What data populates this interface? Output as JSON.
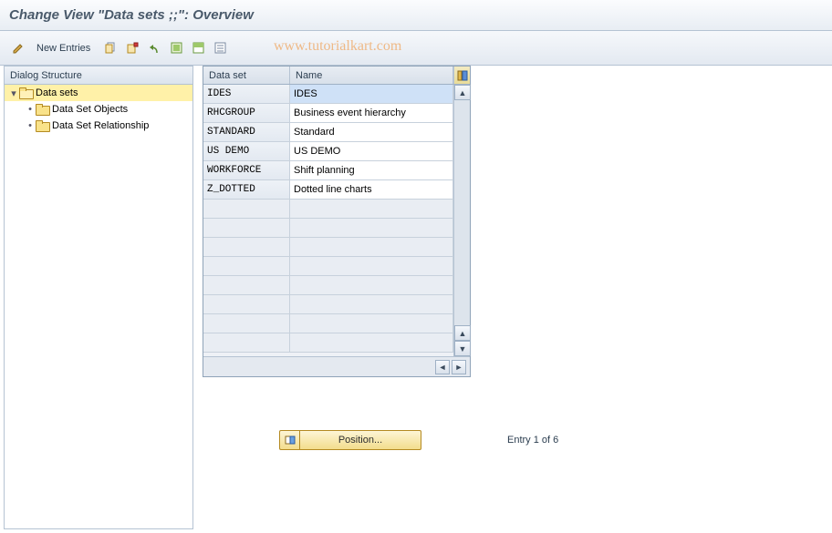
{
  "page_title": "Change View \"Data sets                    ;;\": Overview",
  "toolbar": {
    "new_entries": "New Entries"
  },
  "watermark": "www.tutorialkart.com",
  "tree": {
    "header": "Dialog Structure",
    "root": {
      "label": "Data sets",
      "children": [
        {
          "label": "Data Set Objects"
        },
        {
          "label": "Data Set Relationship"
        }
      ]
    }
  },
  "grid": {
    "columns": {
      "c1": "Data set",
      "c2": "Name"
    },
    "rows": [
      {
        "data_set": "IDES",
        "name": "IDES",
        "selected": true
      },
      {
        "data_set": "RHCGROUP",
        "name": "Business event hierarchy",
        "selected": false
      },
      {
        "data_set": "STANDARD",
        "name": "Standard",
        "selected": false
      },
      {
        "data_set": "US DEMO",
        "name": "US DEMO",
        "selected": false
      },
      {
        "data_set": "WORKFORCE",
        "name": "Shift planning",
        "selected": false
      },
      {
        "data_set": "Z_DOTTED",
        "name": "Dotted line charts",
        "selected": false
      }
    ],
    "empty_rows": 8
  },
  "footer": {
    "position_label": "Position...",
    "entry_label": "Entry 1 of 6"
  }
}
